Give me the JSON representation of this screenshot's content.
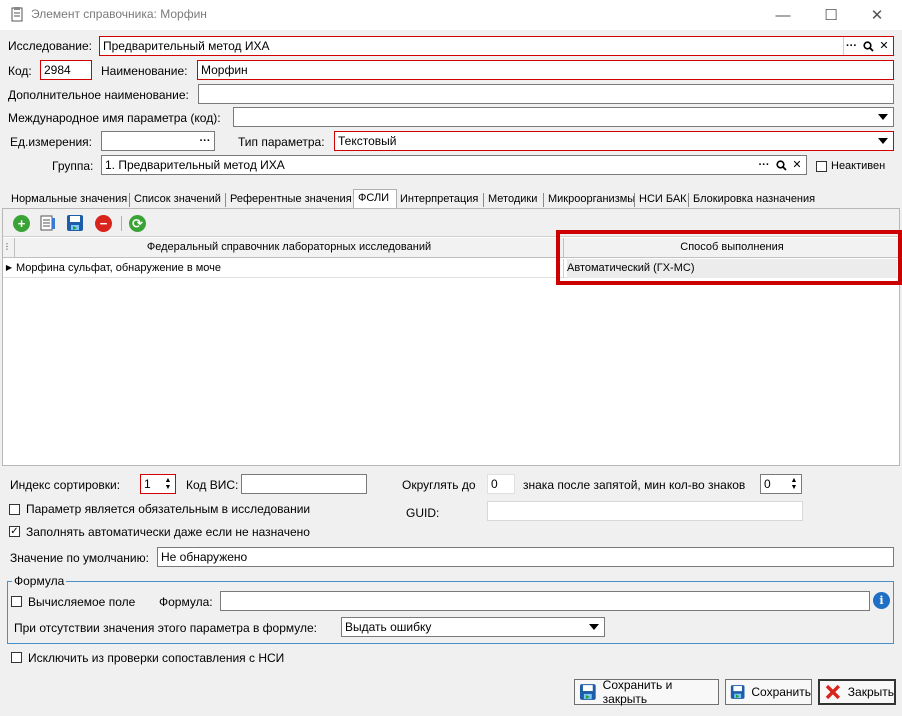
{
  "window": {
    "title": "Элемент справочника: Морфин",
    "minimize": "—",
    "maximize": "☐",
    "close": "✕"
  },
  "header": {
    "study_label": "Исследование:",
    "study_value": "Предварительный метод ИХА",
    "code_label": "Код:",
    "code_value": "2984",
    "name_label": "Наименование:",
    "name_value": "Морфин",
    "extra_name_label": "Дополнительное наименование:",
    "extra_name_value": "",
    "intl_name_label": "Международное имя параметра (код):",
    "intl_name_value": "",
    "unit_label": "Ед.измерения:",
    "unit_value": "",
    "param_type_label": "Тип параметра:",
    "param_type_value": "Текстовый",
    "group_label": "Группа:",
    "group_value": "1. Предварительный метод ИХА",
    "inactive_label": "Неактивен",
    "ellipsis": "···",
    "clear": "✕"
  },
  "tabs": [
    {
      "label": "Нормальные значения"
    },
    {
      "label": "Список значений"
    },
    {
      "label": "Референтные значения"
    },
    {
      "label": "ФСЛИ"
    },
    {
      "label": "Интерпретация"
    },
    {
      "label": "Методики"
    },
    {
      "label": "Микроорганизмы"
    },
    {
      "label": "НСИ БАК"
    },
    {
      "label": "Блокировка назначения"
    }
  ],
  "grid": {
    "col1_header": "Федеральный справочник лабораторных исследований",
    "col2_header": "Способ выполнения",
    "rows": [
      {
        "col1": "Морфина сульфат, обнаружение в моче",
        "col2": "Автоматический (ГХ-МС)"
      }
    ]
  },
  "bottom": {
    "sort_index_label": "Индекс сортировки:",
    "sort_index_value": "1",
    "vis_code_label": "Код ВИС:",
    "vis_code_value": "",
    "round_label": "Округлять до",
    "round_value": "0",
    "decimals_label": "знака после запятой, мин кол-во знаков",
    "min_digits_value": "0",
    "guid_label": "GUID:",
    "guid_value": "",
    "required_label": "Параметр является обязательным в исследовании",
    "autofill_label": "Заполнять автоматически даже если не назначено",
    "default_label": "Значение по умолчанию:",
    "default_value": "Не обнаружено",
    "formula_group_label": "Формула",
    "computed_label": "Вычисляемое поле",
    "formula_label": "Формула:",
    "formula_value": "",
    "missing_label": "При отсутствии значения этого параметра в формуле:",
    "missing_value": "Выдать ошибку",
    "exclude_label": "Исключить из проверки сопоставления с НСИ"
  },
  "buttons": {
    "save_close": "Сохранить и закрыть",
    "save": "Сохранить",
    "close": "Закрыть"
  },
  "colors": {
    "highlight": "#cc0000",
    "field_error_border": "#d20000"
  }
}
